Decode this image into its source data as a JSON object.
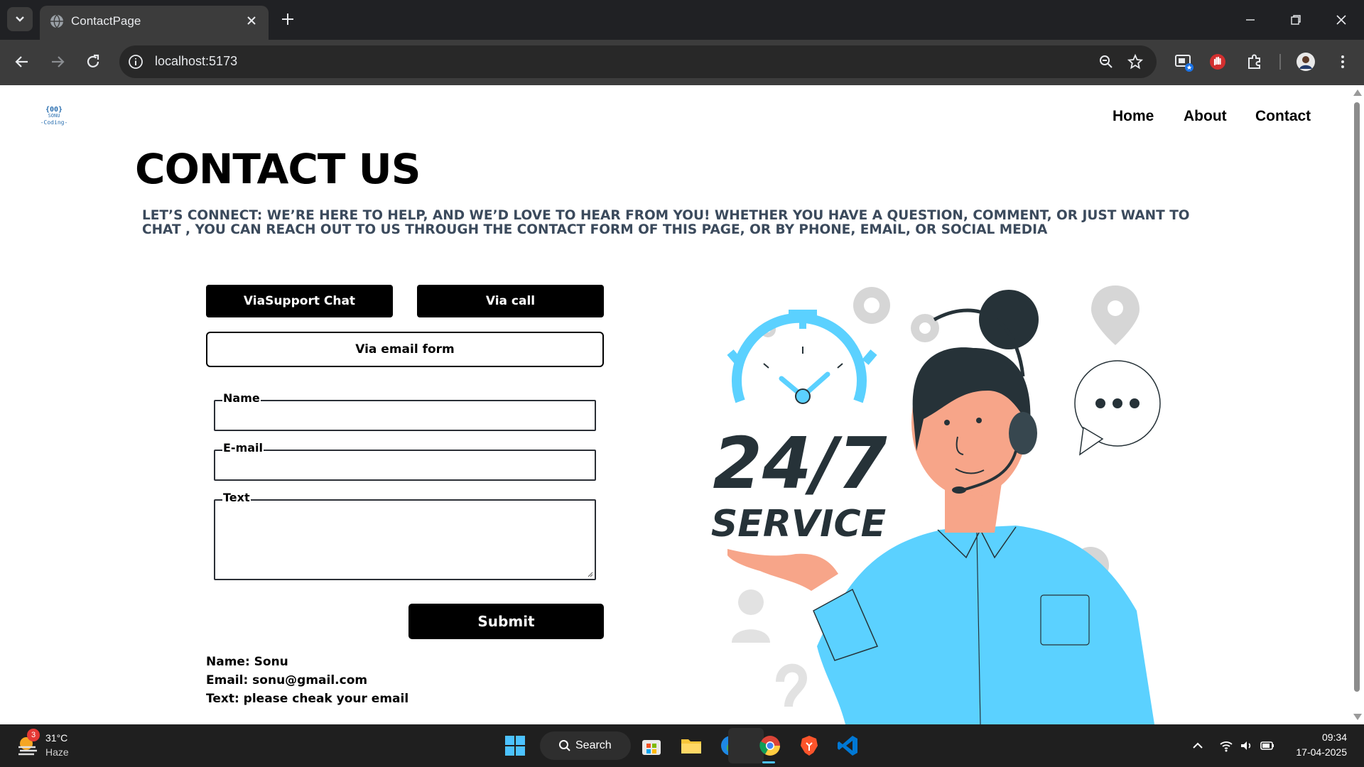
{
  "browser": {
    "tab_title": "ContactPage",
    "url": "localhost:5173"
  },
  "site": {
    "logo_text_top": "{00}",
    "logo_text_mid": "SONU",
    "logo_text_bottom": "-Coding-",
    "nav": [
      "Home",
      "About",
      "Contact"
    ]
  },
  "contact": {
    "title": "CONTACT US",
    "subtitle": "LET’S CONNECT: WE’RE HERE TO HELP, AND WE’D LOVE TO HEAR FROM YOU! WHETHER YOU HAVE A QUESTION, COMMENT, OR JUST WANT TO CHAT , YOU CAN REACH OUT TO US THROUGH THE CONTACT FORM OF THIS PAGE, OR BY PHONE, EMAIL, OR SOCIAL MEDIA",
    "buttons": {
      "support_chat": "ViaSupport Chat",
      "call": "Via call",
      "email_form": "Via email form"
    },
    "form": {
      "name_label": "Name",
      "email_label": "E-mail",
      "text_label": "Text",
      "name_value": "",
      "email_value": "",
      "text_value": "",
      "submit_label": "Submit"
    },
    "submitted": {
      "name": "Name: Sonu",
      "email": "Email: sonu@gmail.com",
      "text": "Text: please cheak your email"
    },
    "illustration": {
      "headline": "24/7",
      "subline": "SERVICE"
    }
  },
  "taskbar": {
    "weather_badge": "3",
    "temperature": "31°C",
    "condition": "Haze",
    "search_label": "Search",
    "time": "09:34",
    "date": "17-04-2025"
  },
  "colors": {
    "accent_blue": "#5bd1ff",
    "dark_text": "#263238",
    "button_black": "#000000"
  },
  "icons": [
    "tab-search-icon",
    "globe-icon",
    "close-icon",
    "plus-icon",
    "minimize-icon",
    "restore-icon",
    "back-icon",
    "forward-icon",
    "reload-icon",
    "info-icon",
    "zoom-icon",
    "star-icon",
    "windows-icon",
    "search-icon",
    "store-icon",
    "folder-icon",
    "edge-icon",
    "chrome-icon",
    "brave-icon",
    "vscode-icon",
    "wifi-icon",
    "volume-icon",
    "battery-icon"
  ]
}
